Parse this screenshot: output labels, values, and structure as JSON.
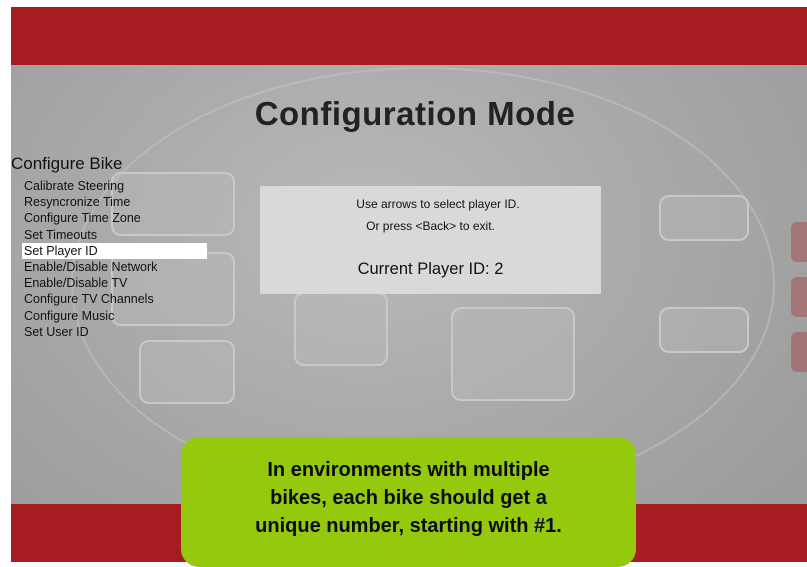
{
  "screen": {
    "title": "Configuration Mode"
  },
  "menu": {
    "heading": "Configure Bike",
    "items": [
      {
        "label": "Calibrate Steering"
      },
      {
        "label": "Resyncronize Time"
      },
      {
        "label": "Configure Time Zone"
      },
      {
        "label": "Set Timeouts"
      },
      {
        "label": "Set Player ID",
        "selected": true
      },
      {
        "label": "Enable/Disable Network"
      },
      {
        "label": "Enable/Disable TV"
      },
      {
        "label": "Configure TV Channels"
      },
      {
        "label": "Configure Music"
      },
      {
        "label": "Set User ID"
      }
    ]
  },
  "dialog": {
    "line1": "Use arrows to select player ID.",
    "line2": "Or press <Back> to exit.",
    "current_player": "Current Player ID: 2"
  },
  "callout": {
    "text_line1": "In environments with multiple",
    "text_line2": "bikes, each bike should get a",
    "text_line3": "unique number, starting with #1."
  },
  "colors": {
    "band_red": "#a61c20",
    "callout_green": "#94c90d",
    "selected_row": "#ffffff"
  }
}
